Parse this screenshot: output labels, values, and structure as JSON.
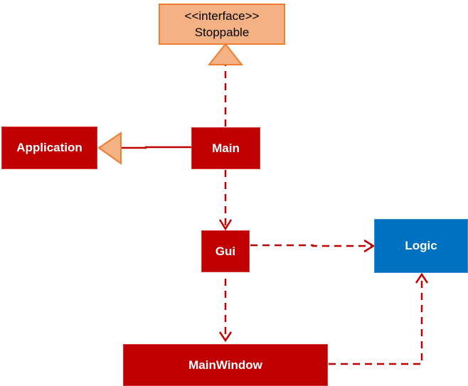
{
  "diagram": {
    "type": "uml-class-diagram",
    "colors": {
      "class_fill": "#C00000",
      "interface_fill": "#F4B183",
      "interface_border": "#ED7D31",
      "external_fill": "#0070C0",
      "edge": "#C00000",
      "text_light": "#FFFFFF",
      "text_dark": "#000000"
    },
    "nodes": {
      "stoppable": {
        "stereotype": "<<interface>>",
        "label": "Stoppable"
      },
      "application": {
        "label": "Application"
      },
      "main": {
        "label": "Main"
      },
      "gui": {
        "label": "Gui"
      },
      "logic": {
        "label": "Logic"
      },
      "mainwindow": {
        "label": "MainWindow"
      }
    },
    "edges": [
      {
        "from": "Main",
        "to": "Stoppable",
        "kind": "realization",
        "style": "dashed",
        "head": "hollow-triangle"
      },
      {
        "from": "Main",
        "to": "Application",
        "kind": "inheritance",
        "style": "solid",
        "head": "hollow-triangle"
      },
      {
        "from": "Main",
        "to": "Gui",
        "kind": "dependency",
        "style": "dashed",
        "head": "open-arrow"
      },
      {
        "from": "Gui",
        "to": "Logic",
        "kind": "dependency",
        "style": "dashed",
        "head": "open-arrow"
      },
      {
        "from": "Gui",
        "to": "MainWindow",
        "kind": "dependency",
        "style": "dashed",
        "head": "open-arrow"
      },
      {
        "from": "MainWindow",
        "to": "Logic",
        "kind": "dependency",
        "style": "dashed",
        "head": "open-arrow"
      }
    ]
  }
}
